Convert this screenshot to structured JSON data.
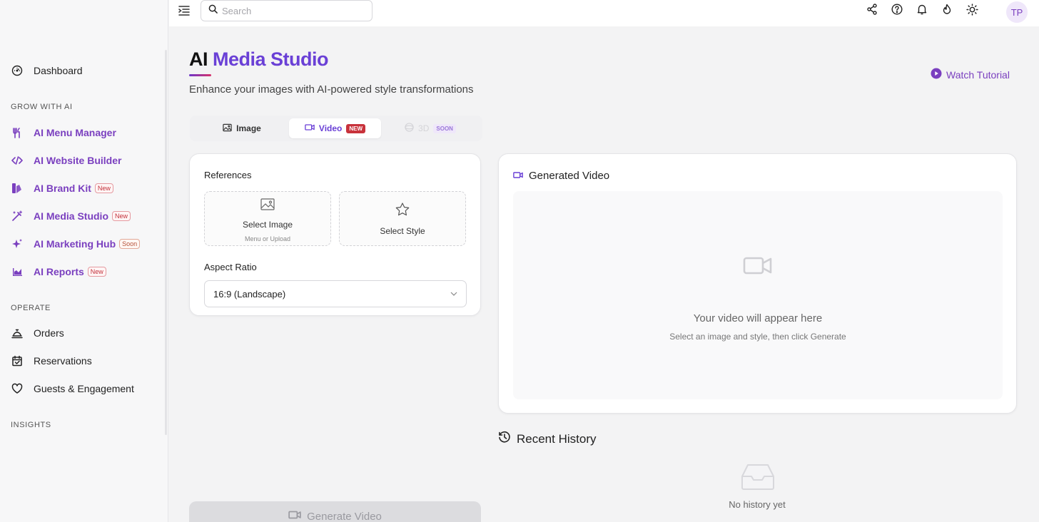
{
  "header": {
    "search_placeholder": "Search",
    "icons": [
      "menu-toggle-icon",
      "share-icon",
      "help-icon",
      "bell-icon",
      "flame-icon",
      "sun-icon"
    ],
    "avatar_initials": "TP"
  },
  "sidebar": {
    "dashboard": "Dashboard",
    "sections": {
      "grow": "GROW WITH AI",
      "operate": "OPERATE",
      "insights": "INSIGHTS"
    },
    "ai_items": [
      {
        "label": "AI Menu Manager",
        "badge": ""
      },
      {
        "label": "AI Website Builder",
        "badge": ""
      },
      {
        "label": "AI Brand Kit",
        "badge": "New"
      },
      {
        "label": "AI Media Studio",
        "badge": "New"
      },
      {
        "label": "AI Marketing Hub",
        "badge": "Soon"
      },
      {
        "label": "AI Reports",
        "badge": "New"
      }
    ],
    "operate_items": [
      {
        "label": "Orders"
      },
      {
        "label": "Reservations"
      },
      {
        "label": "Guests & Engagement"
      }
    ],
    "accent_color": "#7a3fbf"
  },
  "main": {
    "title_part1": "AI",
    "title_part2": "Media Studio",
    "subtitle": "Enhance your images with AI-powered style transformations",
    "watch_tutorial": "Watch Tutorial",
    "tabs": [
      {
        "label": "Image",
        "badge": "",
        "state": "default"
      },
      {
        "label": "Video",
        "badge": "NEW",
        "state": "active"
      },
      {
        "label": "3D",
        "badge": "SOON",
        "state": "disabled"
      }
    ],
    "references": {
      "label": "References",
      "select_image": "Select Image",
      "select_image_sub": "Menu or Upload",
      "select_style": "Select Style"
    },
    "aspect_ratio": {
      "label": "Aspect Ratio",
      "value": "16:9 (Landscape)"
    },
    "generated": {
      "title": "Generated Video",
      "empty_title": "Your video will appear here",
      "empty_sub": "Select an image and style, then click Generate"
    },
    "history": {
      "title": "Recent History",
      "empty": "No history yet"
    },
    "generate_button": "Generate Video"
  }
}
